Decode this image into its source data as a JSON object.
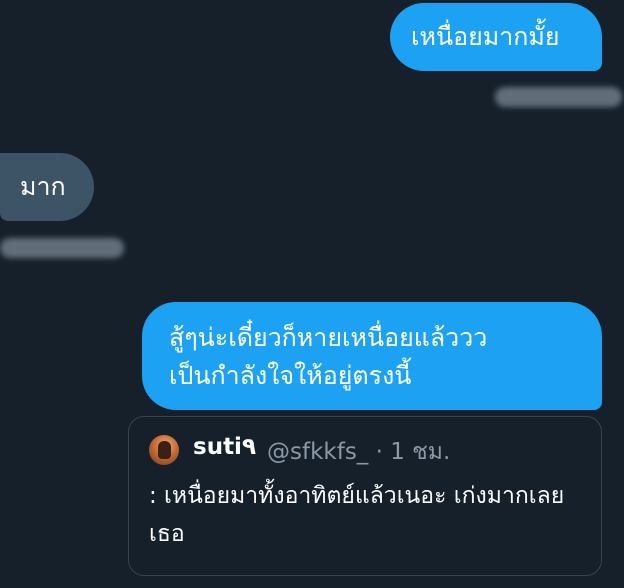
{
  "conversation": {
    "messages": [
      {
        "direction": "outgoing",
        "text": "เหนื่อยมากมั้ย"
      },
      {
        "direction": "incoming",
        "text": "มาก"
      },
      {
        "direction": "outgoing",
        "lines": [
          "สู้ๆน่ะเดี๋ยวก็หายเหนื่อยแล้ววว",
          "เป็นกำลังใจให้อยู่ตรงนี้"
        ]
      }
    ],
    "quoted_tweet": {
      "display_name": "suti٩",
      "handle_time": "@sfkkfs_ · 1 ชม.",
      "text": ": เหนื่อยมาทั้งอาทิตย์แล้วเนอะ เก่งมากเลยเธอ"
    }
  },
  "colors": {
    "background": "#15202b",
    "outgoing_bubble": "#1da1f2",
    "incoming_bubble": "#3d5466",
    "card_border": "#38444d",
    "muted_text": "#8b98a5"
  }
}
